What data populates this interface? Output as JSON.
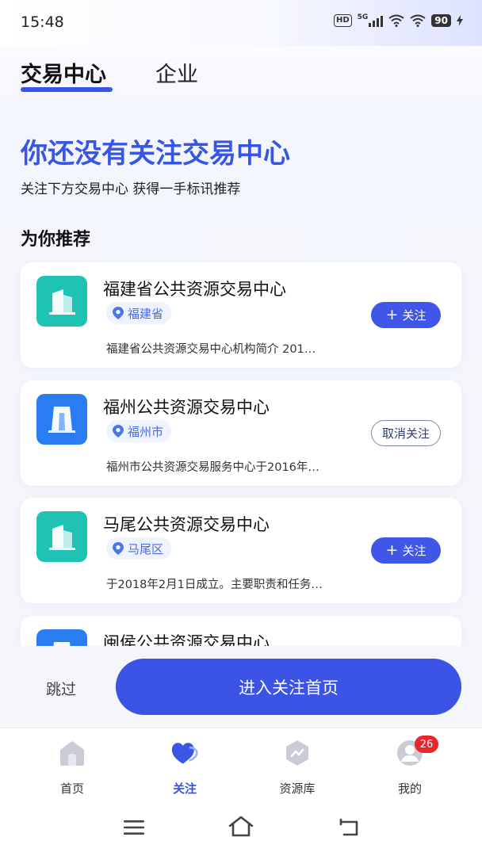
{
  "status_bar": {
    "time": "15:48",
    "hd_label": "HD",
    "network": "5G",
    "battery": "90"
  },
  "tabs": [
    {
      "label": "交易中心",
      "active": true
    },
    {
      "label": "企业",
      "active": false
    }
  ],
  "headline": "你还没有关注交易中心",
  "subline": "关注下方交易中心 获得一手标讯推荐",
  "section_title": "为你推荐",
  "cards": [
    {
      "title": "福建省公共资源交易中心",
      "location": "福建省",
      "description": "福建省公共资源交易中心机构简介  201…",
      "action_label": "关注",
      "action_prefix": "+",
      "followed": false,
      "icon_color": "#1fc3b5"
    },
    {
      "title": "福州公共资源交易中心",
      "location": "福州市",
      "description": "福州市公共资源交易服务中心于2016年…",
      "action_label": "取消关注",
      "followed": true,
      "icon_color": "#2a7df0"
    },
    {
      "title": "马尾公共资源交易中心",
      "location": "马尾区",
      "description": "于2018年2月1日成立。主要职责和任务…",
      "action_label": "关注",
      "action_prefix": "+",
      "followed": false,
      "icon_color": "#1fc3b5"
    },
    {
      "title": "闽侯公共资源交易中心",
      "icon_color": "#2a7df0"
    }
  ],
  "bottom_actions": {
    "skip_label": "跳过",
    "enter_label": "进入关注首页"
  },
  "bottom_nav": [
    {
      "label": "首页",
      "icon": "home-icon",
      "active": false
    },
    {
      "label": "关注",
      "icon": "heart-icon",
      "active": true
    },
    {
      "label": "资源库",
      "icon": "resource-icon",
      "active": false
    },
    {
      "label": "我的",
      "icon": "user-icon",
      "active": false,
      "badge": "26"
    }
  ],
  "colors": {
    "accent": "#3b54e6",
    "headline": "#3856e5",
    "badge": "#e8262c",
    "teal_icon": "#1fc3b5",
    "blue_icon": "#2a7df0"
  }
}
